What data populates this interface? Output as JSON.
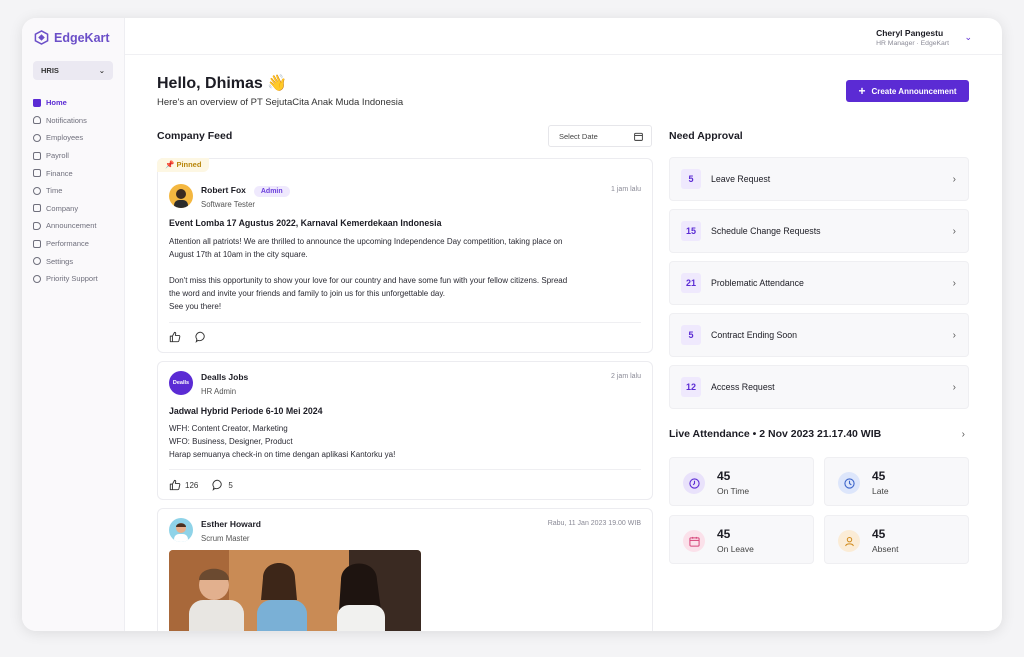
{
  "app": {
    "name": "EdgeKart",
    "module": "HRIS"
  },
  "sidebar": {
    "items": [
      {
        "label": "Home",
        "icon": "home-icon",
        "active": true
      },
      {
        "label": "Notifications",
        "icon": "bell-icon"
      },
      {
        "label": "Employees",
        "icon": "users-icon"
      },
      {
        "label": "Payroll",
        "icon": "payroll-icon"
      },
      {
        "label": "Finance",
        "icon": "finance-icon"
      },
      {
        "label": "Time",
        "icon": "clock-icon"
      },
      {
        "label": "Company",
        "icon": "building-icon"
      },
      {
        "label": "Announcement",
        "icon": "megaphone-icon"
      },
      {
        "label": "Performance",
        "icon": "chart-icon"
      },
      {
        "label": "Settings",
        "icon": "gear-icon"
      },
      {
        "label": "Priority Support",
        "icon": "support-icon"
      }
    ]
  },
  "user": {
    "name": "Cheryl Pangestu",
    "role": "HR Manager · EdgeKart"
  },
  "header": {
    "greeting": "Hello, Dhimas 👋",
    "subtitle": "Here's an overview of PT SejutaCita Anak Muda Indonesia",
    "create_button": "Create Announcement"
  },
  "feed": {
    "title": "Company Feed",
    "date_placeholder": "Select Date",
    "posts": [
      {
        "pinned_label": "Pinned",
        "author": "Robert Fox",
        "badge": "Admin",
        "role": "Software Tester",
        "time": "1 jam lalu",
        "title": "Event Lomba 17 Agustus 2022, Karnaval Kemerdekaan Indonesia",
        "body": [
          "Attention all patriots! We are thrilled to announce the upcoming Independence Day competition, taking place on",
          "August 17th at 10am in the city square.",
          "",
          "Don't miss this opportunity to show your love for our country and have some fun with your fellow citizens. Spread",
          "the word and invite your friends and family to join us for this unforgettable day.",
          "See you there!"
        ]
      },
      {
        "author": "Dealls Jobs",
        "avatar_text": "Dealls",
        "role": "HR Admin",
        "time": "2 jam lalu",
        "title": "Jadwal Hybrid Periode 6-10 Mei 2024",
        "body": [
          "WFH: Content Creator, Marketing",
          "WFO: Business, Designer, Product",
          "Harap semuanya check-in on time dengan aplikasi Kantorku ya!"
        ],
        "likes": "126",
        "comments": "5"
      },
      {
        "author": "Esther Howard",
        "role": "Scrum Master",
        "time": "Rabu, 11 Jan 2023 19.00 WIB"
      }
    ]
  },
  "approval": {
    "title": "Need Approval",
    "items": [
      {
        "count": "5",
        "label": "Leave Request"
      },
      {
        "count": "15",
        "label": "Schedule Change Requests"
      },
      {
        "count": "21",
        "label": "Problematic Attendance"
      },
      {
        "count": "5",
        "label": "Contract Ending Soon"
      },
      {
        "count": "12",
        "label": "Access Request"
      }
    ]
  },
  "attendance": {
    "title": "Live Attendance • 2 Nov 2023 21.17.40 WIB",
    "cards": [
      {
        "value": "45",
        "label": "On Time",
        "color": "#e9e2fb",
        "icon": "clock-icon"
      },
      {
        "value": "45",
        "label": "Late",
        "color": "#dde6fb",
        "icon": "clock-icon"
      },
      {
        "value": "45",
        "label": "On Leave",
        "color": "#fbe1ea",
        "icon": "calendar-icon"
      },
      {
        "value": "45",
        "label": "Absent",
        "color": "#fbecd6",
        "icon": "person-icon"
      }
    ]
  },
  "colors": {
    "accent": "#5b2bd4"
  }
}
